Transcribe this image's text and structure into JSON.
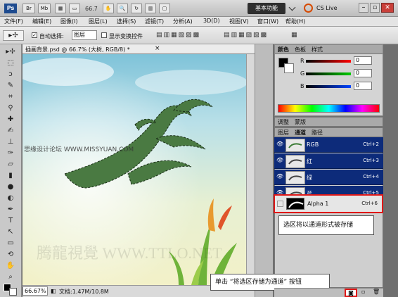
{
  "app": {
    "logo": "Ps",
    "top_icons": [
      "Br",
      "Mb"
    ],
    "zoom_readout": "66.7",
    "workspace_label": "基本功能",
    "cslive_label": "CS Live"
  },
  "menu": [
    "文件(F)",
    "编辑(E)",
    "图像(I)",
    "图层(L)",
    "选择(S)",
    "滤镜(T)",
    "分析(A)",
    "3D(D)",
    "视图(V)",
    "窗口(W)",
    "帮助(H)"
  ],
  "options": {
    "auto_select_label": "自动选择:",
    "auto_select_value": "图层",
    "show_transform_label": "显示变换控件"
  },
  "document": {
    "tab_title": "插画背景.psd @ 66.7% (大树, RGB/8) *",
    "zoom_status": "66.67%",
    "doc_size": "文档:1.47M/10.8M"
  },
  "watermarks": {
    "top_left": "思缘设计论坛 WWW.MISSYUAN.COM",
    "bottom": "腾龍視覺  WWW.TTLO.NET"
  },
  "color_panel": {
    "tabs": [
      "颜色",
      "色板",
      "样式"
    ],
    "sliders": [
      {
        "label": "R",
        "value": "0",
        "color": "#cc0000"
      },
      {
        "label": "G",
        "value": "0",
        "color": "#00a000"
      },
      {
        "label": "B",
        "value": "0",
        "color": "#0033cc"
      }
    ]
  },
  "adjust_tabs": [
    "调整",
    "蒙版"
  ],
  "layer_panel": {
    "tabs": [
      "图层",
      "通道",
      "路径"
    ],
    "channels": [
      {
        "name": "RGB",
        "shortcut": "Ctrl+2"
      },
      {
        "name": "红",
        "shortcut": "Ctrl+3"
      },
      {
        "name": "绿",
        "shortcut": "Ctrl+4"
      },
      {
        "name": "蓝",
        "shortcut": "Ctrl+5"
      }
    ],
    "alpha": {
      "name": "Alpha 1",
      "shortcut": "Ctrl+6"
    }
  },
  "callouts": {
    "channel": "选区将以通道形式被存储",
    "button": "单击 “将选区存储为通道” 按钮"
  }
}
